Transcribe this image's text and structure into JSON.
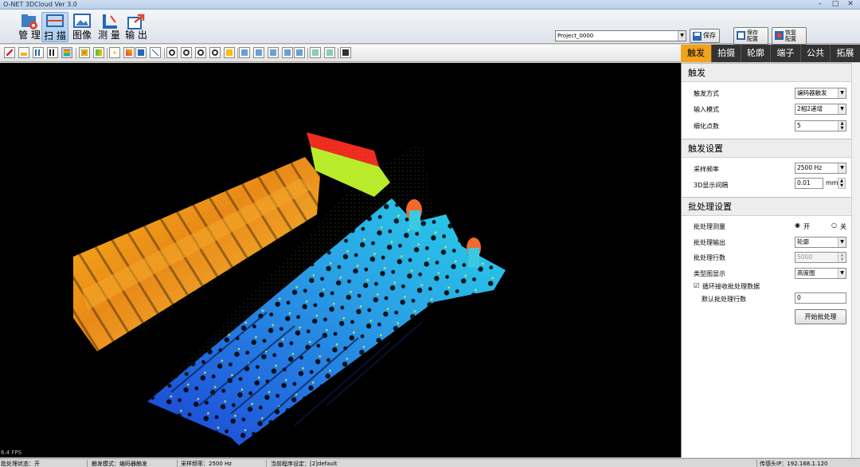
{
  "window": {
    "title": "O-NET 3DCloud Ver 3.0",
    "buttons": [
      "–",
      "□",
      "✕"
    ]
  },
  "ribbon": {
    "items": [
      {
        "label": "管 理",
        "icon": "gear-folder-icon"
      },
      {
        "label": "扫 描",
        "icon": "scan-icon"
      },
      {
        "label": "图像",
        "icon": "image-icon"
      },
      {
        "label": "测 量",
        "icon": "ruler-icon"
      },
      {
        "label": "输 出",
        "icon": "export-icon"
      }
    ],
    "active_index": 1
  },
  "project": {
    "value": "Project_0000",
    "save_label": "保存",
    "save_config_label": "保存\n配置",
    "restore_config_label": "恢复\n配置"
  },
  "tabs": [
    {
      "label": "触发",
      "active": true
    },
    {
      "label": "拍摄",
      "active": false
    },
    {
      "label": "轮廓",
      "active": false
    },
    {
      "label": "端子",
      "active": false
    },
    {
      "label": "公共",
      "active": false
    },
    {
      "label": "拓展",
      "active": false
    }
  ],
  "panel": {
    "trigger": {
      "header": "触发",
      "mode_label": "触发方式",
      "mode_value": "编码器触发",
      "input_label": "输入模式",
      "input_value": "2相2递增",
      "subdiv_label": "细化点数",
      "subdiv_value": "5"
    },
    "trigger_settings": {
      "header": "触发设置",
      "rate_label": "采样频率",
      "rate_value": "2500 Hz",
      "interval_label": "3D显示间隔",
      "interval_value": "0.01",
      "interval_unit": "mm"
    },
    "batch": {
      "header": "批处理设置",
      "measure_label": "批处理测量",
      "on_label": "开",
      "off_label": "关",
      "output_label": "批处理输出",
      "output_value": "轮廓",
      "rows_label": "批处理行数",
      "rows_value": "5000",
      "type_label": "类型图显示",
      "type_value": "高度图",
      "loop_label": "循环接收批处理数据",
      "default_rows_label": "默认批处理行数",
      "default_rows_value": "0",
      "start_button": "开始批处理"
    }
  },
  "viewport": {
    "fps": "6.4 FPS"
  },
  "status": {
    "batch_state": "批处理状态：开",
    "trigger_mode": "触发模式：编码器触发",
    "sample_rate": "采样频率：2500 Hz",
    "program": "当前程序设定：[2]default",
    "sensor_ip": "传感头IP：192.168.1.120"
  }
}
